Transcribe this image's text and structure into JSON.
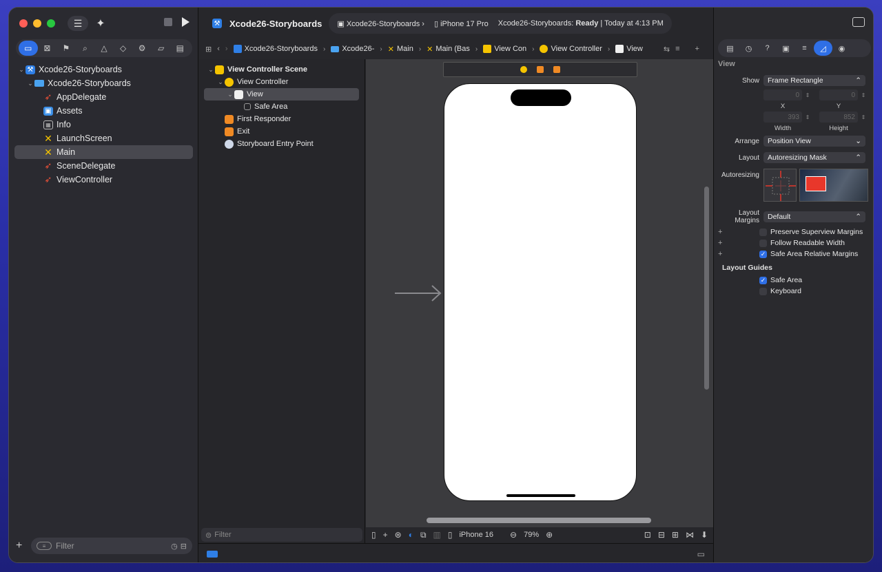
{
  "navigator": {
    "tree": [
      {
        "label": "Xcode26-Storyboards",
        "icon": "project-icon",
        "level": 0,
        "expanded": true
      },
      {
        "label": "Xcode26-Storyboards",
        "icon": "folder-icon",
        "level": 1,
        "expanded": true
      },
      {
        "label": "AppDelegate",
        "icon": "swift-file-icon",
        "level": 2
      },
      {
        "label": "Assets",
        "icon": "asset-catalog-icon",
        "level": 2
      },
      {
        "label": "Info",
        "icon": "plist-icon",
        "level": 2
      },
      {
        "label": "LaunchScreen",
        "icon": "storyboard-icon",
        "level": 2
      },
      {
        "label": "Main",
        "icon": "storyboard-icon",
        "level": 2,
        "selected": true
      },
      {
        "label": "SceneDelegate",
        "icon": "swift-file-icon",
        "level": 2
      },
      {
        "label": "ViewController",
        "icon": "swift-file-icon",
        "level": 2
      }
    ],
    "filter_placeholder": "Filter"
  },
  "toolbar": {
    "project_name": "Xcode26-Storyboards",
    "scheme": "Xcode26-Storyboards",
    "device": "iPhone 17 Pro",
    "status_prefix": "Xcode26-Storyboards:",
    "status_state": "Ready",
    "status_time": "| Today at 4:13 PM"
  },
  "jumpbar": {
    "crumbs": [
      "Xcode26-Storyboards",
      "Xcode26-",
      "Main",
      "Main (Bas",
      "View Con",
      "View Controller",
      "View"
    ]
  },
  "outline": {
    "rows": [
      {
        "label": "View Controller Scene",
        "level": 0,
        "icon_color": "#f5c400",
        "bold": true,
        "disclosure": "v"
      },
      {
        "label": "View Controller",
        "level": 1,
        "icon_color": "#f5c400",
        "disclosure": "v",
        "round": true
      },
      {
        "label": "View",
        "level": 2,
        "icon_color": "#f0f0f0",
        "disclosure": "v",
        "selected": true
      },
      {
        "label": "Safe Area",
        "level": 3,
        "icon_color": "none"
      },
      {
        "label": "First Responder",
        "level": 1,
        "icon_color": "#f08a24"
      },
      {
        "label": "Exit",
        "level": 1,
        "icon_color": "#f08a24"
      },
      {
        "label": "Storyboard Entry Point",
        "level": 1,
        "icon_color": "#cfd8e8",
        "round": true
      }
    ],
    "filter_placeholder": "Filter"
  },
  "canvas_bottom": {
    "device": "iPhone 16",
    "zoom": "79%"
  },
  "inspector": {
    "section": "View",
    "show_label": "Show",
    "show_value": "Frame Rectangle",
    "x_value": "0",
    "y_value": "0",
    "x_caption": "X",
    "y_caption": "Y",
    "width_value": "393",
    "height_value": "852",
    "width_caption": "Width",
    "height_caption": "Height",
    "arrange_label": "Arrange",
    "arrange_value": "Position View",
    "layout_label": "Layout",
    "layout_value": "Autoresizing Mask",
    "autoresizing_label": "Autoresizing",
    "layout_margins_label": "Layout Margins",
    "layout_margins_value": "Default",
    "checks": [
      {
        "label": "Preserve Superview Margins",
        "checked": false
      },
      {
        "label": "Follow Readable Width",
        "checked": false
      },
      {
        "label": "Safe Area Relative Margins",
        "checked": true
      }
    ],
    "layout_guides_title": "Layout Guides",
    "guides": [
      {
        "label": "Safe Area",
        "checked": true
      },
      {
        "label": "Keyboard",
        "checked": false
      }
    ]
  },
  "colors": {
    "accent": "#2f6fe6",
    "storyboard_icon": "#f5c400",
    "swift_icon": "#f05138"
  }
}
